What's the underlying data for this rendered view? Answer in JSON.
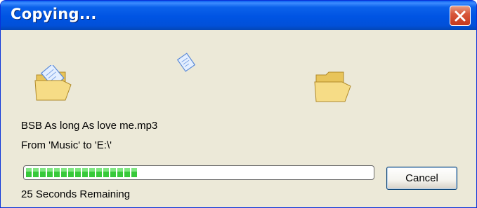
{
  "window": {
    "title": "Copying..."
  },
  "icons": {
    "source": "folder-open-icon",
    "flying": "document-icon",
    "destination": "folder-open-icon"
  },
  "file": {
    "name": "BSB As long As love me.mp3",
    "route": "From 'Music' to 'E:\\'"
  },
  "progress": {
    "fraction": 0.32
  },
  "buttons": {
    "cancel": "Cancel"
  },
  "status": {
    "remaining": "25 Seconds Remaining"
  },
  "colors": {
    "titlebar": "#0054e3",
    "background": "#ece9d8",
    "progress": "#37c93a",
    "close": "#d8573a"
  }
}
